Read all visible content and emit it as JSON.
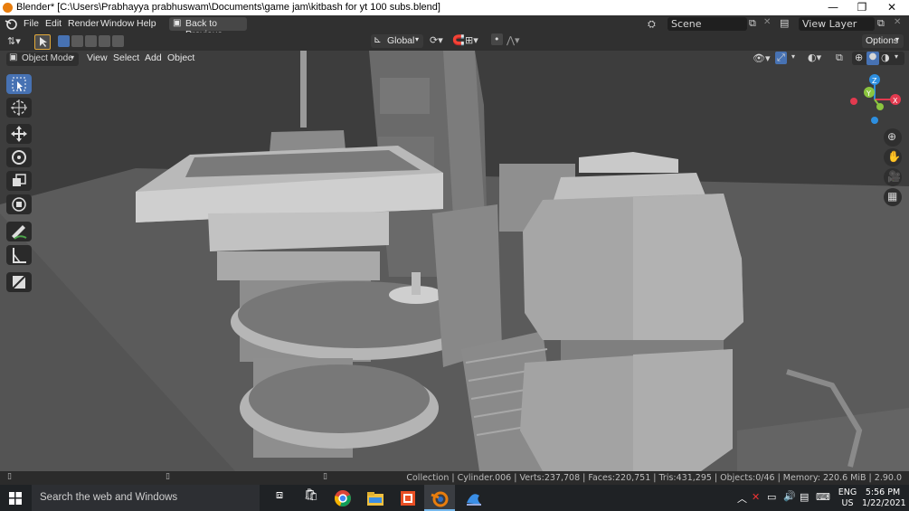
{
  "window": {
    "title": "Blender* [C:\\Users\\Prabhayya prabhuswam\\Documents\\game jam\\kitbash for yt 100 subs.blend]",
    "minimize": "—",
    "restore": "❐",
    "close": "✕"
  },
  "menubar": {
    "items": [
      "File",
      "Edit",
      "Render",
      "Window",
      "Help"
    ],
    "back_button": "Back to Previous",
    "scene_label": "Scene",
    "view_layer_label": "View Layer"
  },
  "toolbar": {
    "transform_orientation": "Global",
    "options": "Options"
  },
  "viewport_header": {
    "mode": "Object Mode",
    "menus": [
      "View",
      "Select",
      "Add",
      "Object"
    ]
  },
  "tools": [
    "select-box-icon",
    "cursor-icon",
    "move-icon",
    "rotate-icon",
    "scale-icon",
    "transform-icon",
    "annotate-icon",
    "measure-icon",
    "add-cube-icon"
  ],
  "navigation": [
    "zoom-icon",
    "pan-hand-icon",
    "camera-icon",
    "grid-icon"
  ],
  "gizmo": {
    "x": "X",
    "y": "Y",
    "z": "Z",
    "colors": {
      "x": "#e33a4f",
      "y": "#8bc53f",
      "z": "#2d8fe0"
    }
  },
  "statusbar": {
    "text": "Collection | Cylinder.006 | Verts:237,708 | Faces:220,751 | Tris:431,295 | Objects:0/46 | Memory: 220.6 MiB | 2.90.0"
  },
  "taskbar": {
    "search_placeholder": "Search the web and Windows",
    "lang_top": "ENG",
    "lang_bottom": "US",
    "time": "5:56 PM",
    "date": "1/22/2021"
  },
  "colors": {
    "accent": "#4772b3",
    "blender_orange": "#e87d0d",
    "viewport_bg": "#3d3d3d"
  }
}
